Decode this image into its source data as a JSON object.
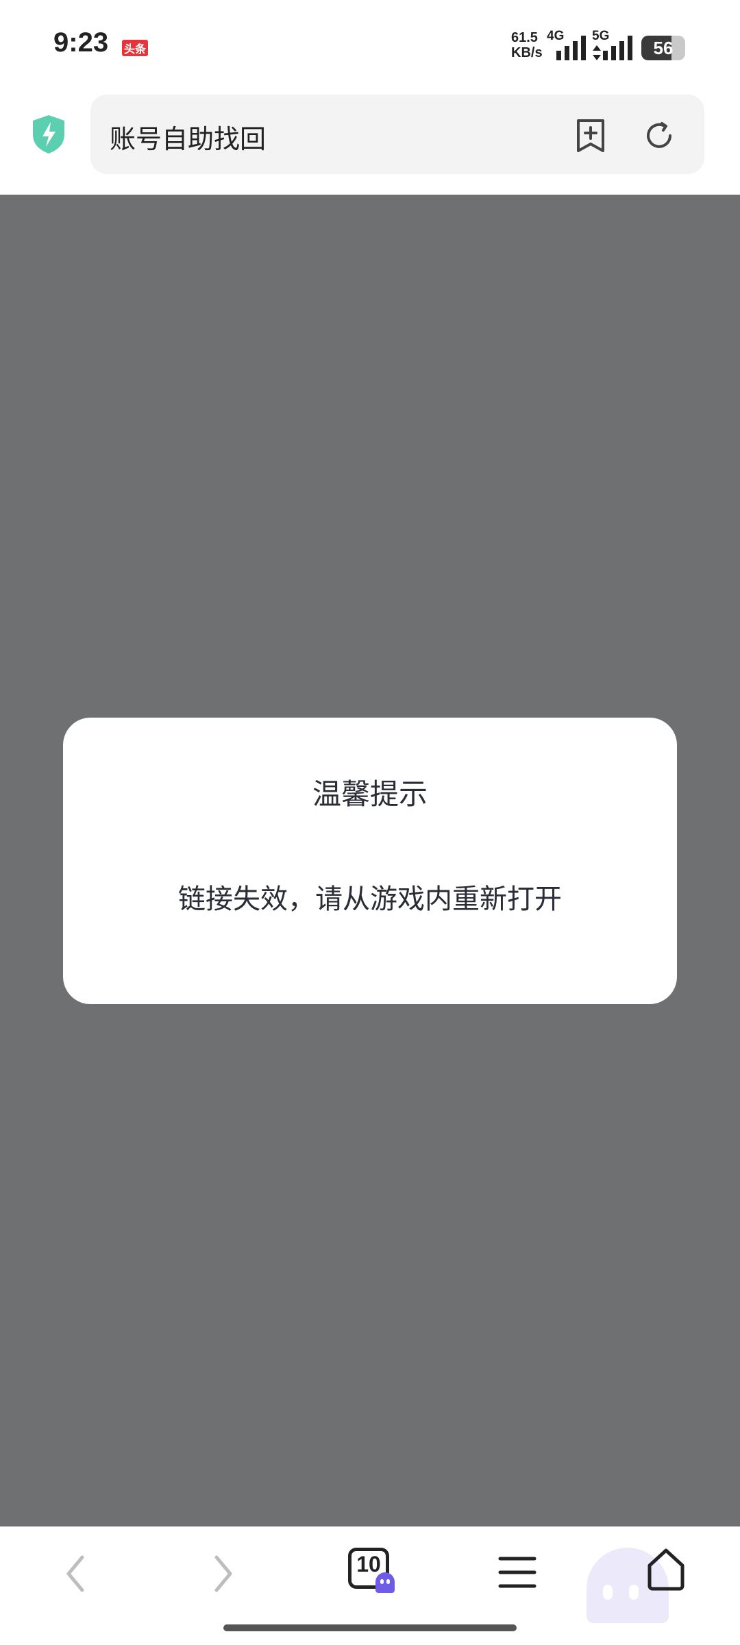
{
  "status_bar": {
    "time": "9:23",
    "app_badge": "头条",
    "network_speed_value": "61.5",
    "network_speed_unit": "KB/s",
    "network_type_1": "4G",
    "network_type_2": "5G",
    "battery_level": "56"
  },
  "address_bar": {
    "page_title": "账号自助找回",
    "security_icon": "shield-bolt-icon",
    "bookmark_icon": "add-bookmark-icon",
    "refresh_icon": "refresh-icon"
  },
  "dialog": {
    "title": "温馨提示",
    "message": "链接失效，请从游戏内重新打开"
  },
  "toolbar": {
    "tab_count": "10",
    "back_icon": "chevron-left-icon",
    "forward_icon": "chevron-right-icon",
    "menu_icon": "menu-icon",
    "home_icon": "home-icon"
  },
  "colors": {
    "overlay": "#6f7072",
    "shield": "#5ccfb0",
    "ghost_badge": "#6f5ce6",
    "app_badge": "#e5343b"
  }
}
